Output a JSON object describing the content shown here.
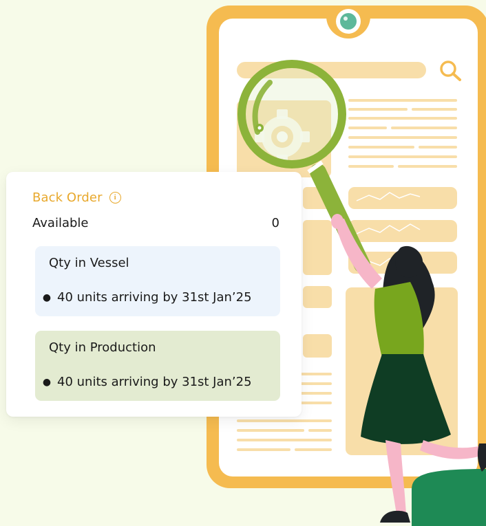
{
  "card": {
    "title": "Back Order",
    "info_icon": "info-circle-icon",
    "available_label": "Available",
    "available_value": "0",
    "sections": [
      {
        "title": "Qty in Vessel",
        "items": [
          "40 units arriving by 31st Jan’25"
        ],
        "color": "#edf4fc"
      },
      {
        "title": "Qty in Production",
        "items": [
          "40 units arriving by 31st Jan’25"
        ],
        "color": "#e3ebd1"
      }
    ]
  },
  "colors": {
    "background": "#f7fbe9",
    "accent": "#e8a82c",
    "phone_frame": "#f5bb50",
    "phone_screen_tint": "#f8dea9",
    "magnifier": "#8cb33a"
  },
  "illustration": {
    "icons": [
      "phone-illustration",
      "magnifier-illustration",
      "gear-icon",
      "search-icon",
      "woman-illustration"
    ]
  }
}
